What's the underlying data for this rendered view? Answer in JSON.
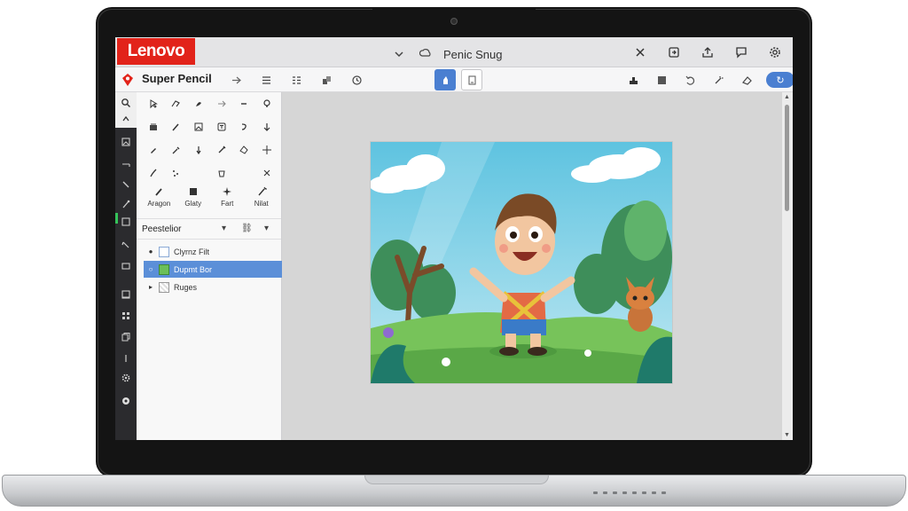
{
  "device": {
    "brand": "Lenovo"
  },
  "titlebar": {
    "title": "Penic Snug",
    "buttons": [
      "close-icon",
      "snap-icon",
      "share-icon",
      "chat-icon",
      "settings-icon"
    ]
  },
  "toolbar": {
    "app_name": "Super Pencil",
    "pill_label": "↻"
  },
  "tools": {
    "row5_labels": [
      "Aragon",
      "Glaty",
      "Fart",
      "Nilat"
    ]
  },
  "layers": {
    "title": "Peestelior",
    "items": [
      {
        "name": "Clyrnz Filt",
        "selected": false
      },
      {
        "name": "Dupmt Bor",
        "selected": true
      },
      {
        "name": "Ruges",
        "selected": false
      }
    ]
  },
  "colors": {
    "brand": "#e2231a",
    "accent": "#4a7fd1",
    "rail": "#2b2b2e",
    "selection": "#5b8fd8"
  }
}
